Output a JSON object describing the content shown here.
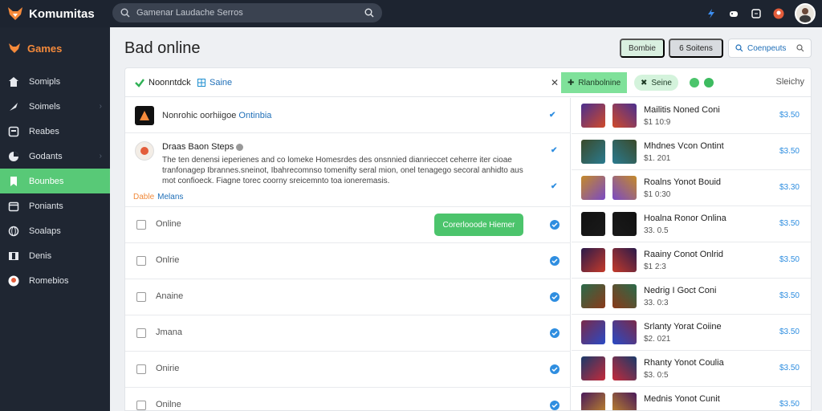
{
  "app": {
    "name": "Komumitas"
  },
  "search": {
    "placeholder": "Gamenar Laudache Serros"
  },
  "sidebar": {
    "header": "Games",
    "items": [
      {
        "label": "Somipls",
        "icon": "home-icon",
        "chevron": false,
        "active": false
      },
      {
        "label": "Soimels",
        "icon": "rocket-icon",
        "chevron": true,
        "active": false
      },
      {
        "label": "Reabes",
        "icon": "square-icon",
        "chevron": false,
        "active": false
      },
      {
        "label": "Godants",
        "icon": "pie-chart-icon",
        "chevron": true,
        "active": false
      },
      {
        "label": "Bounbes",
        "icon": "bookmark-icon",
        "chevron": false,
        "active": true
      },
      {
        "label": "Poniants",
        "icon": "calendar-icon",
        "chevron": false,
        "active": false
      },
      {
        "label": "Soalaps",
        "icon": "globe-icon",
        "chevron": false,
        "active": false
      },
      {
        "label": "Denis",
        "icon": "columns-icon",
        "chevron": false,
        "active": false
      },
      {
        "label": "Romebios",
        "icon": "avatar-icon",
        "chevron": false,
        "active": false
      }
    ]
  },
  "page": {
    "title": "Bad online"
  },
  "header_buttons": {
    "b1": "Bombie",
    "b2": "6 Soitens",
    "b3": "Coenpeuts"
  },
  "tabs": {
    "t1": "Noonntdck",
    "t2": "Saine",
    "t3": "Rlanbolnine",
    "t4": "Seine",
    "right": "Sleichy"
  },
  "feature": {
    "label_prefix": "Nonrohic oorhiigoe",
    "label_link": "Ontinbia"
  },
  "post": {
    "title": "Draas Baon Steps",
    "body": "The ten denensi ieperienes and co lomeke Homesrdes des onsnnied dianrieccet ceherre iter cioae tranfonagep Ibrannes.sneinot, Ibahrecomnso tomenifty seral mion, onel tenagego secoral anhidto aus mot confioeck. Fiagne torec coorny sreicemnto toa ioneremasis.",
    "tag_a": "Dable",
    "tag_b": "Melans"
  },
  "list": {
    "rows": [
      "Online",
      "Onlrie",
      "Anaine",
      "Jmana",
      "Onirie",
      "Onilne"
    ],
    "button": "Corerlooode Hiemer"
  },
  "games": [
    {
      "name": "Mailitis Noned Coni",
      "price": "$1 10:9",
      "count": "$3.50"
    },
    {
      "name": "Mhdnes Vcon Ontint",
      "price": "$1. 201",
      "count": "$3.50"
    },
    {
      "name": "Roalns Yonot Bouid",
      "price": "$1 0:30",
      "count": "$3.30"
    },
    {
      "name": "Hoalna Ronor Onlina",
      "price": "33. 0.5",
      "count": "$3.50"
    },
    {
      "name": "Raainy Conot Onlrid",
      "price": "$1 2:3",
      "count": "$3.50"
    },
    {
      "name": "Nedrig I Goct Coni",
      "price": "33. 0:3",
      "count": "$3.50"
    },
    {
      "name": "Srlanty Yorat Coiine",
      "price": "$2. 021",
      "count": "$3.50"
    },
    {
      "name": "Rhanty Yonot Coulia",
      "price": "$3. 0:5",
      "count": "$3.50"
    },
    {
      "name": "Mednis Yonot Cunit",
      "price": "",
      "count": "$3.50"
    }
  ],
  "colors": {
    "accent_green": "#58c977",
    "link_blue": "#1f6fb8",
    "brand_orange": "#f58a3b",
    "topbar": "#1d2430"
  }
}
